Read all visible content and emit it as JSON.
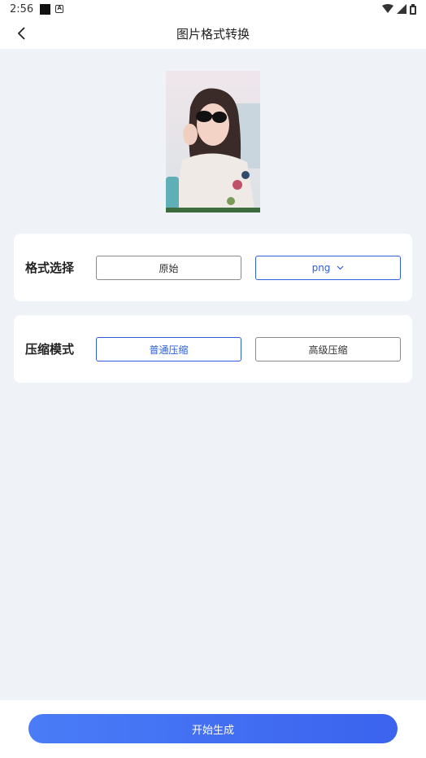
{
  "status_bar": {
    "time": "2:56",
    "icons": [
      "notification-square-icon",
      "a-box-icon",
      "wifi-icon",
      "signal-icon",
      "battery-icon"
    ]
  },
  "header": {
    "title": "图片格式转换",
    "back_icon": "chevron-left-icon"
  },
  "preview": {
    "image_name": "selected-photo"
  },
  "format_section": {
    "label": "格式选择",
    "original_option": "原始",
    "selected_format": "png",
    "dropdown_icon": "chevron-down-icon"
  },
  "compress_section": {
    "label": "压缩模式",
    "normal_option": "普通压缩",
    "advanced_option": "高级压缩",
    "selected": "普通压缩"
  },
  "footer": {
    "start_button": "开始生成"
  },
  "colors": {
    "accent": "#2e5fd8",
    "button_gradient_start": "#4a7cf7",
    "button_gradient_end": "#3b63ee",
    "background": "#eff2f6"
  }
}
